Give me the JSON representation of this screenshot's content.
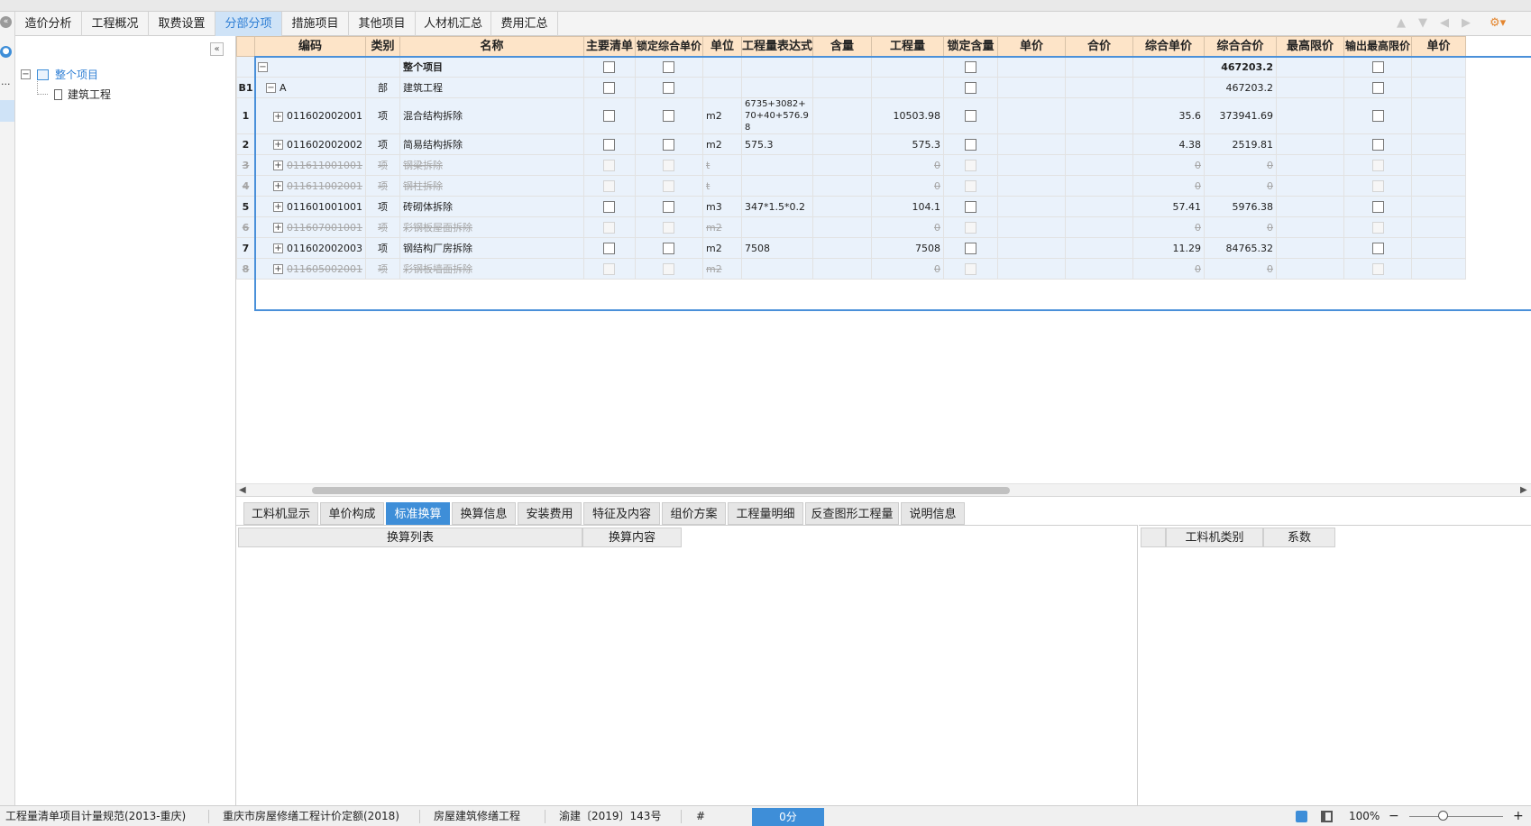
{
  "tabs": [
    {
      "label": "造价分析",
      "active": false
    },
    {
      "label": "工程概况",
      "active": false
    },
    {
      "label": "取费设置",
      "active": false
    },
    {
      "label": "分部分项",
      "active": true
    },
    {
      "label": "措施项目",
      "active": false
    },
    {
      "label": "其他项目",
      "active": false
    },
    {
      "label": "人材机汇总",
      "active": false
    },
    {
      "label": "费用汇总",
      "active": false
    }
  ],
  "toolbar_icons": [
    "arrow-up-icon",
    "arrow-down-icon",
    "arrow-left-icon",
    "arrow-right-icon",
    "settings-dropdown-icon"
  ],
  "left_rail": {
    "dots": "..."
  },
  "tree": {
    "root": {
      "label": "整个项目",
      "icon": "folder-icon",
      "expanded": true
    },
    "child": {
      "label": "建筑工程",
      "icon": "document-icon"
    }
  },
  "grid": {
    "columns": [
      "编码",
      "类别",
      "名称",
      "主要清单",
      "锁定综合单价",
      "单位",
      "工程量表达式",
      "含量",
      "工程量",
      "锁定含量",
      "单价",
      "合价",
      "综合单价",
      "综合合价",
      "最高限价",
      "输出最高限价",
      "单价"
    ],
    "summary_row": {
      "name": "整个项目",
      "total": "467203.2"
    },
    "section_row": {
      "num": "B1",
      "code": "A",
      "type": "部",
      "name": "建筑工程",
      "total": "467203.2"
    },
    "rows": [
      {
        "num": "1",
        "code": "011602002001",
        "type": "项",
        "name": "混合结构拆除",
        "unit": "m2",
        "expr": "6735+3082+70+40+576.98",
        "qty": "10503.98",
        "unit_price": "35.6",
        "total": "373941.69",
        "disabled": false
      },
      {
        "num": "2",
        "code": "011602002002",
        "type": "项",
        "name": "简易结构拆除",
        "unit": "m2",
        "expr": "575.3",
        "qty": "575.3",
        "unit_price": "4.38",
        "total": "2519.81",
        "disabled": false
      },
      {
        "num": "3",
        "code": "011611001001",
        "type": "项",
        "name": "钢梁拆除",
        "unit": "t",
        "expr": "",
        "qty": "0",
        "unit_price": "0",
        "total": "0",
        "disabled": true
      },
      {
        "num": "4",
        "code": "011611002001",
        "type": "项",
        "name": "钢柱拆除",
        "unit": "t",
        "expr": "",
        "qty": "0",
        "unit_price": "0",
        "total": "0",
        "disabled": true
      },
      {
        "num": "5",
        "code": "011601001001",
        "type": "项",
        "name": "砖砌体拆除",
        "unit": "m3",
        "expr": "347*1.5*0.2",
        "qty": "104.1",
        "unit_price": "57.41",
        "total": "5976.38",
        "disabled": false
      },
      {
        "num": "6",
        "code": "011607001001",
        "type": "项",
        "name": "彩钢板屋面拆除",
        "unit": "m2",
        "expr": "",
        "qty": "0",
        "unit_price": "0",
        "total": "0",
        "disabled": true
      },
      {
        "num": "7",
        "code": "011602002003",
        "type": "项",
        "name": "钢结构厂房拆除",
        "unit": "m2",
        "expr": "7508",
        "qty": "7508",
        "unit_price": "11.29",
        "total": "84765.32",
        "disabled": false
      },
      {
        "num": "8",
        "code": "011605002001",
        "type": "项",
        "name": "彩钢板墙面拆除",
        "unit": "m2",
        "expr": "",
        "qty": "0",
        "unit_price": "0",
        "total": "0",
        "disabled": true
      }
    ]
  },
  "bottom_tabs": [
    {
      "label": "工料机显示",
      "active": false
    },
    {
      "label": "单价构成",
      "active": false
    },
    {
      "label": "标准换算",
      "active": true
    },
    {
      "label": "换算信息",
      "active": false
    },
    {
      "label": "安装费用",
      "active": false
    },
    {
      "label": "特征及内容",
      "active": false
    },
    {
      "label": "组价方案",
      "active": false
    },
    {
      "label": "工程量明细",
      "active": false
    },
    {
      "label": "反查图形工程量",
      "active": false
    },
    {
      "label": "说明信息",
      "active": false
    }
  ],
  "lower_left_headers": [
    "换算列表",
    "换算内容"
  ],
  "lower_right_headers": [
    "工料机类别",
    "系数"
  ],
  "status": {
    "items": [
      "工程量清单项目计量规范(2013-重庆)",
      "重庆市房屋修缮工程计价定额(2018)",
      "房屋建筑修缮工程",
      "渝建〔2019〕143号",
      "#"
    ],
    "score": "0分",
    "zoom": "100%",
    "zoom_minus": "−",
    "zoom_plus": "+"
  },
  "colors": {
    "accent": "#3e8ed8",
    "header_bg": "#fde4c8",
    "selected_row": "#eaf2fb",
    "disabled_text": "#a6a6a6"
  }
}
